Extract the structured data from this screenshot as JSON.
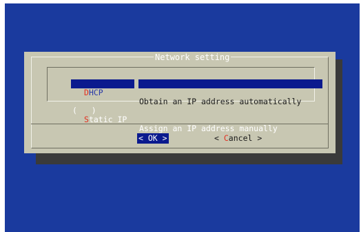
{
  "dialog": {
    "title": "Network setting",
    "options": [
      {
        "radio": "( * )",
        "hotkey": "D",
        "tag_rest": "HCP",
        "description": "Obtain an IP address automatically",
        "selected": false
      },
      {
        "radio": "(   )",
        "hotkey": "S",
        "tag_rest": "tatic IP",
        "description": "Assign an IP address manually",
        "selected": true
      }
    ],
    "buttons": {
      "ok_label": "< OK >",
      "cancel_prefix": "< ",
      "cancel_hotkey": "C",
      "cancel_rest": "ancel >"
    }
  },
  "colors": {
    "screen_background": "#1a3a9e",
    "dialog_background": "#c8c7b2",
    "highlight": "#0b1a8e",
    "hotkey": "#e23020"
  }
}
